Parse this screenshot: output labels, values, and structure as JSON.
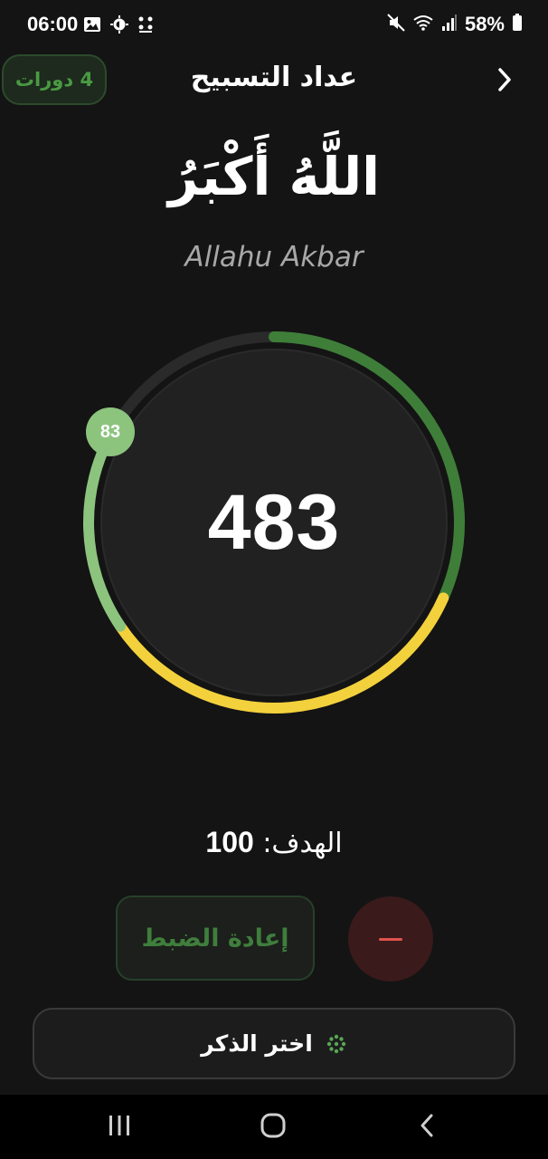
{
  "status_bar": {
    "time": "06:00",
    "battery": "58%",
    "left_icons": [
      "image-icon",
      "brightness-icon",
      "dots-icon"
    ],
    "right_icons": [
      "mute-icon",
      "wifi-icon",
      "signal-icon",
      "battery-icon"
    ]
  },
  "header": {
    "title": "عداد التسبيح",
    "rounds_badge": "4 دورات",
    "back_icon": "chevron-right-icon"
  },
  "dhikr": {
    "arabic": "اللَّهُ أَكْبَرُ",
    "transliteration": "Allahu Akbar"
  },
  "counter": {
    "total": "483",
    "current_round_count": "83",
    "target": 100,
    "round_progress": 0.83,
    "colors": {
      "track": "#2a2a2a",
      "completed_rounds": "#3e7e39",
      "round_progress": "#8cc47e",
      "highlight": "#f3d13c"
    }
  },
  "target": {
    "label": "الهدف:",
    "value": "100"
  },
  "actions": {
    "reset_label": "إعادة الضبط",
    "decrement_icon": "minus-icon",
    "choose_dhikr_label": "اختر الذكر",
    "choose_dhikr_icon": "beads-icon"
  },
  "nav_bar": {
    "icons": [
      "recents-icon",
      "home-icon",
      "back-icon"
    ]
  }
}
